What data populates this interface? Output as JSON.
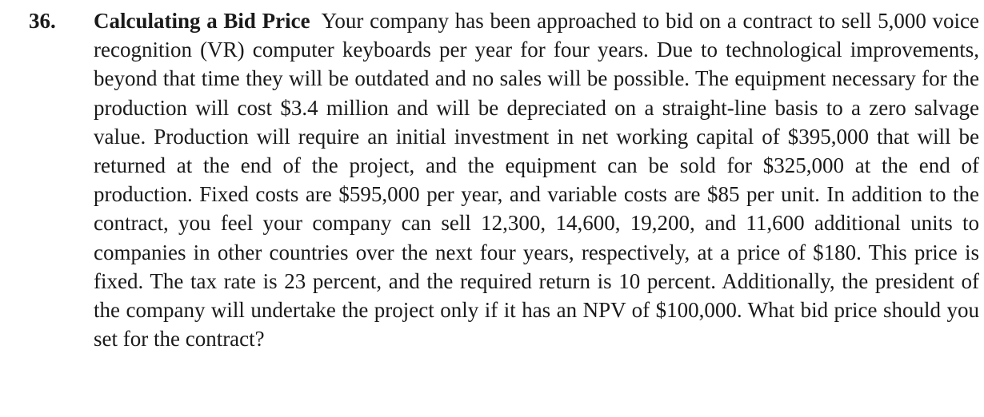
{
  "problem": {
    "number": "36.",
    "title": "Calculating a Bid Price",
    "text": "Your company has been approached to bid on a contract to sell 5,000 voice recognition (VR) computer keyboards per year for four years. Due to technological improvements, beyond that time they will be outdated and no sales will be possible. The equipment necessary for the production will cost $3.4 million and will be depreciated on a straight-line basis to a zero salvage value. Production will require an initial investment in net working capital of $395,000 that will be returned at the end of the project, and the equipment can be sold for $325,000 at the end of production. Fixed costs are $595,000 per year, and variable costs are $85 per unit. In addition to the contract, you feel your company can sell 12,300, 14,600, 19,200, and 11,600 additional units to companies in other countries over the next four years, respectively, at a price of $180. This price is fixed. The tax rate is 23 percent, and the required return is 10 percent. Additionally, the president of the company will under­take the project only if it has an NPV of $100,000. What bid price should you set for the contract?"
  }
}
